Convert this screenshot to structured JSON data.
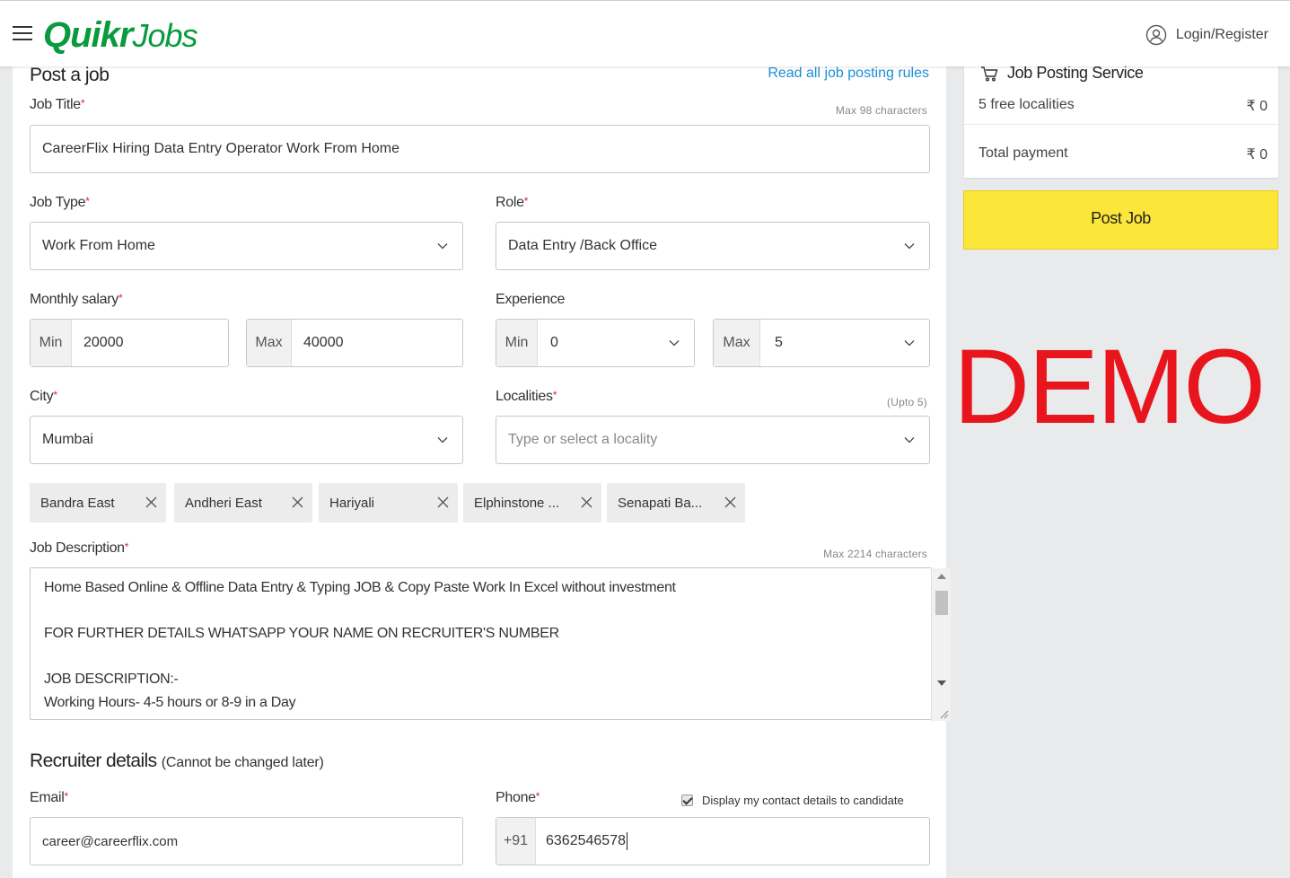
{
  "header": {
    "logo_quikr": "Quikr",
    "logo_jobs": "Jobs",
    "login_label": "Login/Register"
  },
  "form": {
    "title": "Post a job",
    "rules_link": "Read all job posting rules",
    "job_title": {
      "label": "Job Title",
      "hint": "Max 98 characters",
      "value": "CareerFlix Hiring Data Entry Operator Work From Home"
    },
    "job_type": {
      "label": "Job Type",
      "value": "Work From Home"
    },
    "role": {
      "label": "Role",
      "value": "Data Entry /Back Office"
    },
    "salary": {
      "label": "Monthly salary",
      "min_prefix": "Min",
      "min_value": "20000",
      "max_prefix": "Max",
      "max_value": "40000"
    },
    "experience": {
      "label": "Experience",
      "min_prefix": "Min",
      "min_value": "0",
      "max_prefix": "Max",
      "max_value": "5"
    },
    "city": {
      "label": "City",
      "value": "Mumbai"
    },
    "localities": {
      "label": "Localities",
      "hint": "(Upto 5)",
      "placeholder": "Type or select a locality"
    },
    "chips": [
      "Bandra East",
      "Andheri East",
      "Hariyali",
      "Elphinstone ...",
      "Senapati Ba..."
    ],
    "description": {
      "label": "Job Description",
      "hint": "Max 2214 characters",
      "line1": "Home Based Online & Offline Data Entry & Typing JOB & Copy Paste Work In Excel  without investment",
      "line2": "FOR FURTHER DETAILS WHATSAPP YOUR NAME ON RECRUITER'S NUMBER",
      "line3": "JOB DESCRIPTION:-",
      "line4": "Working Hours- 4-5 hours or 8-9 in a Day"
    },
    "recruiter": {
      "title": "Recruiter details",
      "note": "(Cannot be changed later)",
      "email_label": "Email",
      "email_value": "career@careerflix.com",
      "phone_label": "Phone",
      "phone_prefix": "+91",
      "phone_value": "6362546578",
      "display_contact": "Display my contact details to candidate"
    }
  },
  "service": {
    "title": "Job Posting Service",
    "row1_label": "5 free localities",
    "row1_value": "₹ 0",
    "row2_label": "Total payment",
    "row2_value": "₹ 0",
    "post_button": "Post Job"
  },
  "watermark": "DEMO",
  "required_mark": "*"
}
